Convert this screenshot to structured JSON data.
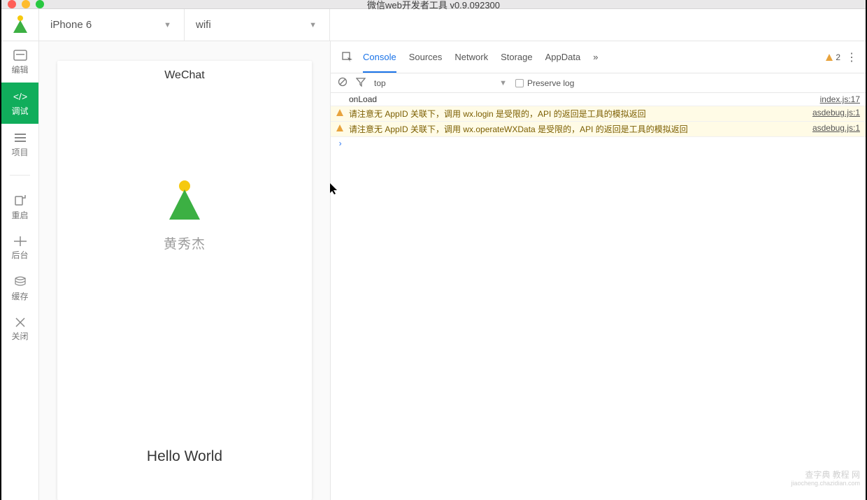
{
  "window": {
    "title": "微信web开发者工具 v0.9.092300"
  },
  "sidebar": {
    "items": [
      {
        "label": "编辑"
      },
      {
        "label": "调试"
      },
      {
        "label": "项目"
      },
      {
        "label": "重启"
      },
      {
        "label": "后台"
      },
      {
        "label": "缓存"
      },
      {
        "label": "关闭"
      }
    ]
  },
  "toolbar": {
    "device": "iPhone 6",
    "network": "wifi"
  },
  "preview": {
    "header": "WeChat",
    "username": "黄秀杰",
    "hello": "Hello World"
  },
  "devtools": {
    "tabs": [
      "Console",
      "Sources",
      "Network",
      "Storage",
      "AppData"
    ],
    "overflow": "»",
    "warning_count": "2",
    "sub": {
      "context": "top",
      "preserve_label": "Preserve log"
    },
    "logs": [
      {
        "type": "plain",
        "msg": "onLoad",
        "src": "index.js:17"
      },
      {
        "type": "warn",
        "msg": "请注意无 AppID 关联下，调用 wx.login 是受限的，API 的返回是工具的模拟返回",
        "src": "asdebug.js:1"
      },
      {
        "type": "warn",
        "msg": "请注意无 AppID 关联下，调用 wx.operateWXData 是受限的，API 的返回是工具的模拟返回",
        "src": "asdebug.js:1"
      }
    ],
    "prompt": "›"
  },
  "watermark": {
    "line1": "查字典 教程 网",
    "line2": "jiaocheng.chazidian.com"
  }
}
